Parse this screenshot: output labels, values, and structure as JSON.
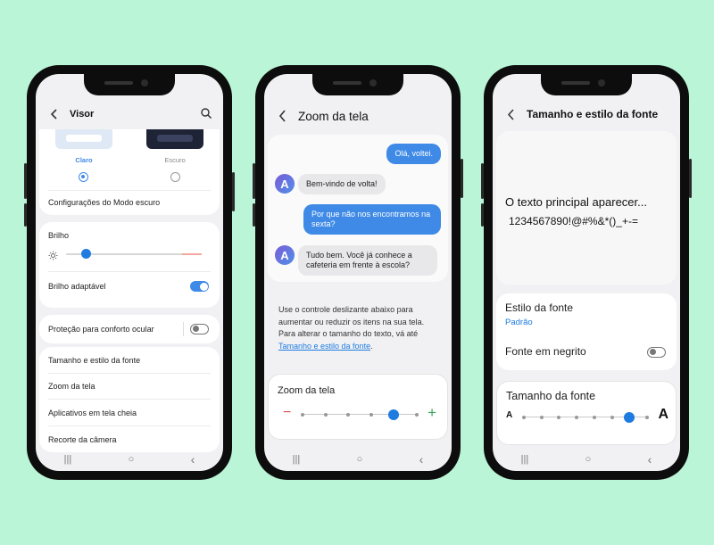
{
  "colors": {
    "background": "#b9f5d6",
    "accent": "#3e8ae6",
    "brightness_end": "#f0a8a0",
    "minus": "#e04848",
    "plus": "#3aa55a"
  },
  "phone1": {
    "title": "Visor",
    "theme_light": "Claro",
    "theme_dark": "Escuro",
    "theme_selected": "Claro",
    "dark_mode_settings": "Configurações do Modo escuro",
    "brightness_label": "Brilho",
    "brightness_level": 0.15,
    "adaptive_brightness": "Brilho adaptável",
    "adaptive_brightness_on": true,
    "eye_comfort": "Proteção para conforto ocular",
    "eye_comfort_on": false,
    "menu": [
      "Tamanho e estilo da fonte",
      "Zoom da tela",
      "Aplicativos em tela cheia",
      "Recorte da câmera"
    ]
  },
  "phone2": {
    "title": "Zoom da tela",
    "messages": [
      {
        "dir": "out",
        "text": "Olá, voltei."
      },
      {
        "dir": "in",
        "text": "Bem-vindo de volta!"
      },
      {
        "dir": "out",
        "text": "Por que não nos encontramos na sexta?"
      },
      {
        "dir": "in",
        "text": "Tudo bem. Você já conhece a cafeteria em frente à escola?"
      }
    ],
    "avatar_letter": "A",
    "description": "Use o controle deslizante abaixo para aumentar ou reduzir os itens na sua tela. Para alterar o tamanho do texto, vá até ",
    "description_link": "Tamanho e estilo da fonte",
    "description_end": ".",
    "slider_label": "Zoom da tela",
    "minus": "−",
    "plus": "+",
    "slider_level": 4,
    "slider_steps": 6
  },
  "phone3": {
    "title": "Tamanho e estilo da fonte",
    "preview_line1": "O texto principal aparecer...",
    "preview_line2": "1234567890!@#%&*()_+-=",
    "font_style_label": "Estilo da fonte",
    "font_style_value": "Padrão",
    "bold_font": "Fonte em negrito",
    "bold_font_on": false,
    "font_size_label": "Tamanho da fonte",
    "small_a": "A",
    "large_a": "A",
    "font_size_level": 6,
    "font_size_steps": 8
  },
  "nav": {
    "recents": "|||",
    "home": "○",
    "back": "‹"
  }
}
